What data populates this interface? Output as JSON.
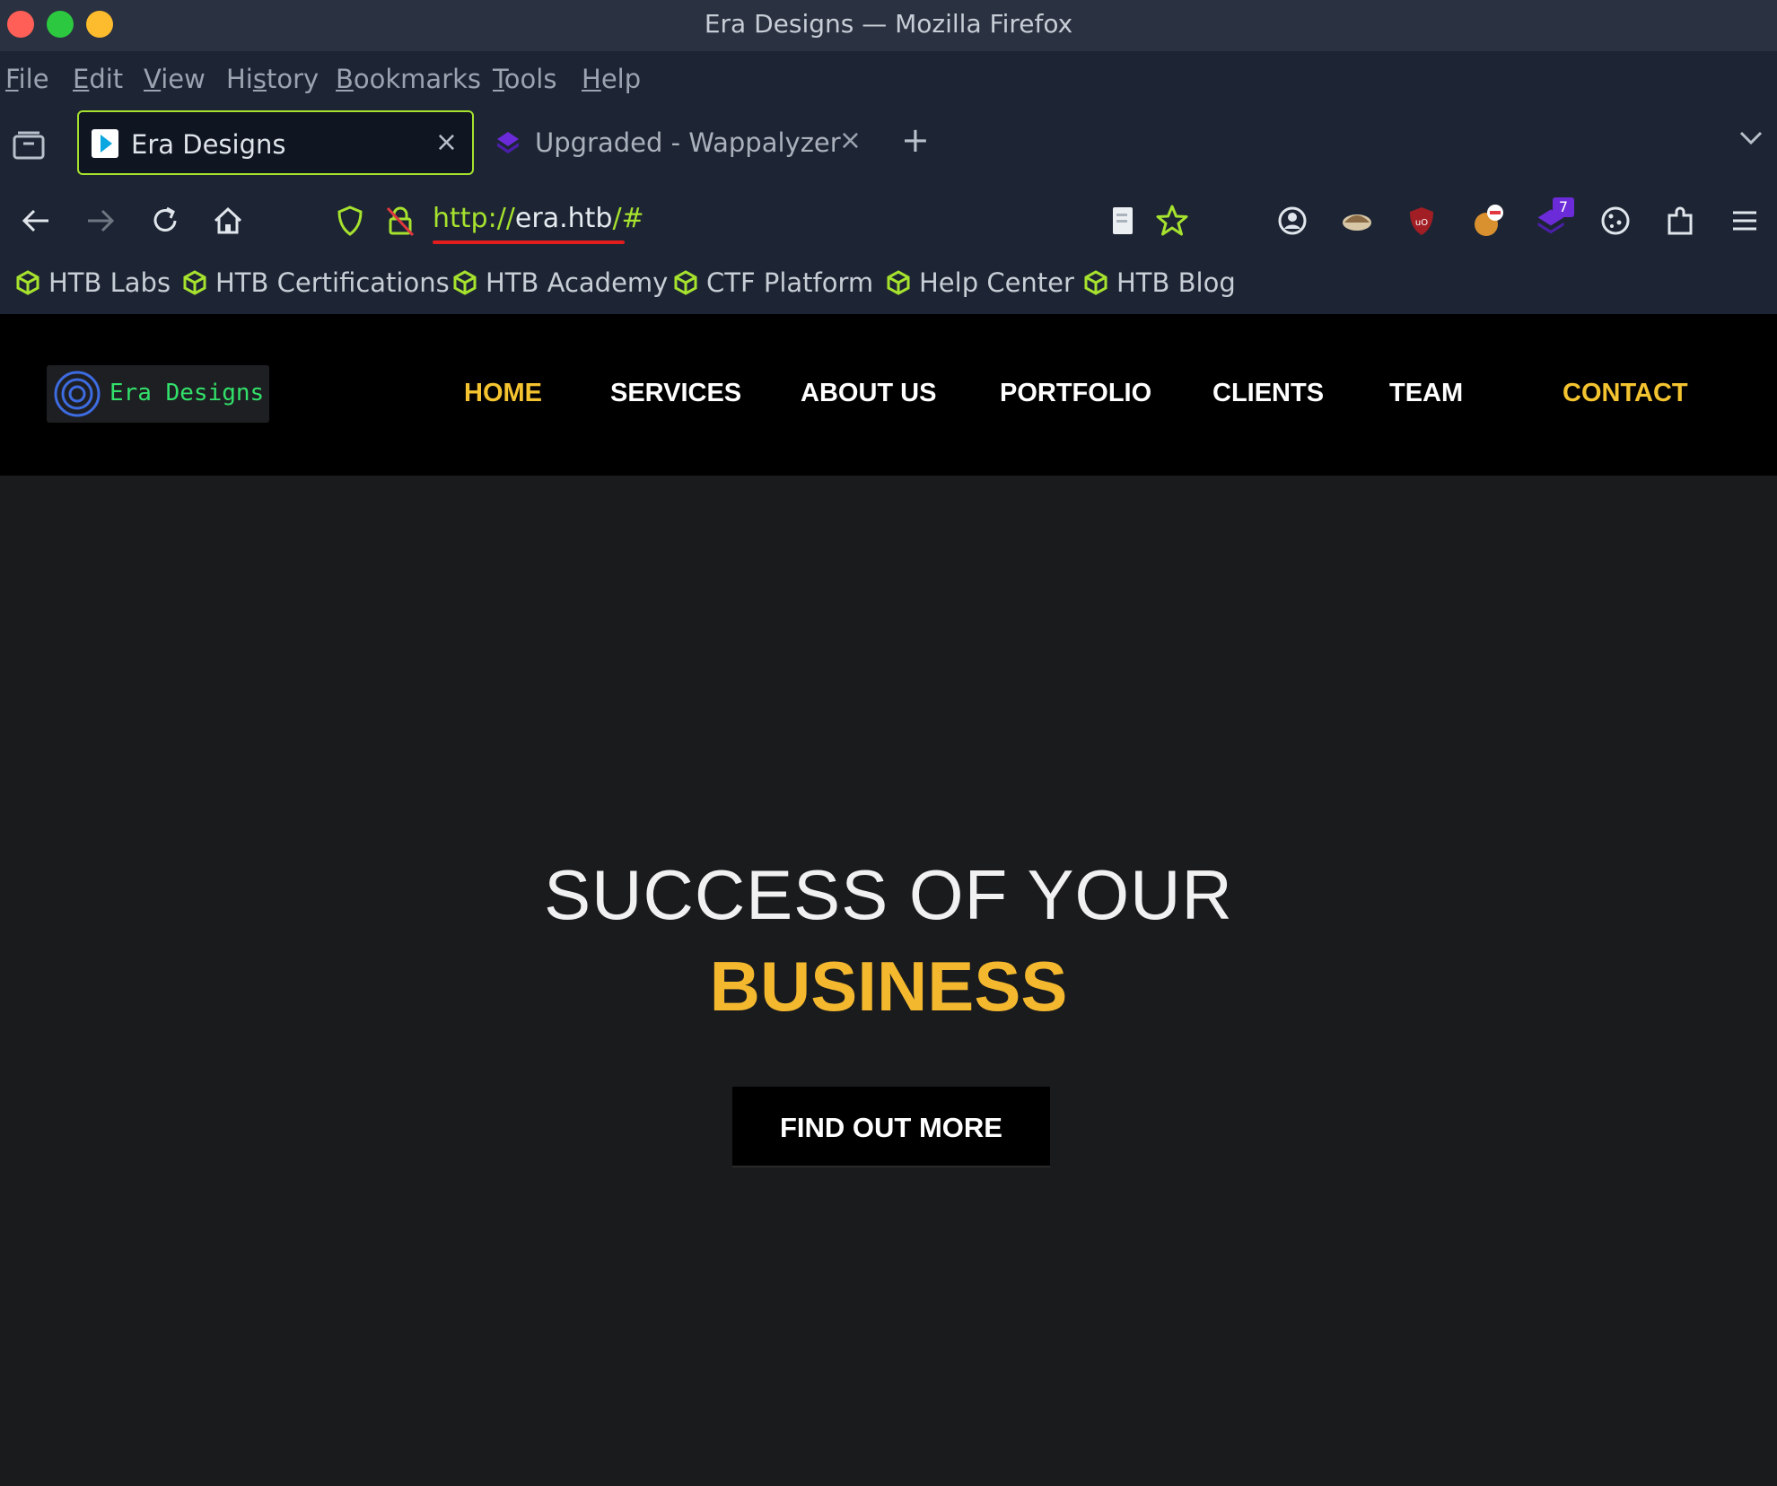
{
  "window": {
    "title": "Era Designs — Mozilla Firefox"
  },
  "menu": {
    "items": [
      {
        "underline": "F",
        "rest": "ile"
      },
      {
        "underline": "E",
        "rest": "dit"
      },
      {
        "underline": "V",
        "rest": "iew"
      },
      {
        "pre": "Hi",
        "underline": "s",
        "rest": "tory"
      },
      {
        "underline": "B",
        "rest": "ookmarks"
      },
      {
        "underline": "T",
        "rest": "ools"
      },
      {
        "underline": "H",
        "rest": "elp"
      }
    ]
  },
  "tabs": {
    "active_label": "Era Designs",
    "inactive_label": "Upgraded - Wappalyzer",
    "close_glyph": "×",
    "newtab_glyph": "+"
  },
  "address": {
    "scheme": "http://",
    "host": "era.htb",
    "suffix": "/#"
  },
  "bookmarks": [
    "HTB Labs",
    "HTB Certifications",
    "HTB Academy",
    "CTF Platform",
    "Help Center",
    "HTB Blog"
  ],
  "site": {
    "logo_text": "Era Designs",
    "nav": [
      "HOME",
      "SERVICES",
      "ABOUT US",
      "PORTFOLIO",
      "CLIENTS",
      "TEAM",
      "CONTACT"
    ],
    "hero_line1": "SUCCESS OF YOUR",
    "hero_line2": "BUSINESS",
    "cta": "FIND OUT MORE"
  },
  "extensions": {
    "badge_count": "7"
  },
  "colors": {
    "accent": "#a6e22e",
    "gold": "#f4c330",
    "logo_green": "#32e06a",
    "url_underline": "#e21d1d"
  }
}
